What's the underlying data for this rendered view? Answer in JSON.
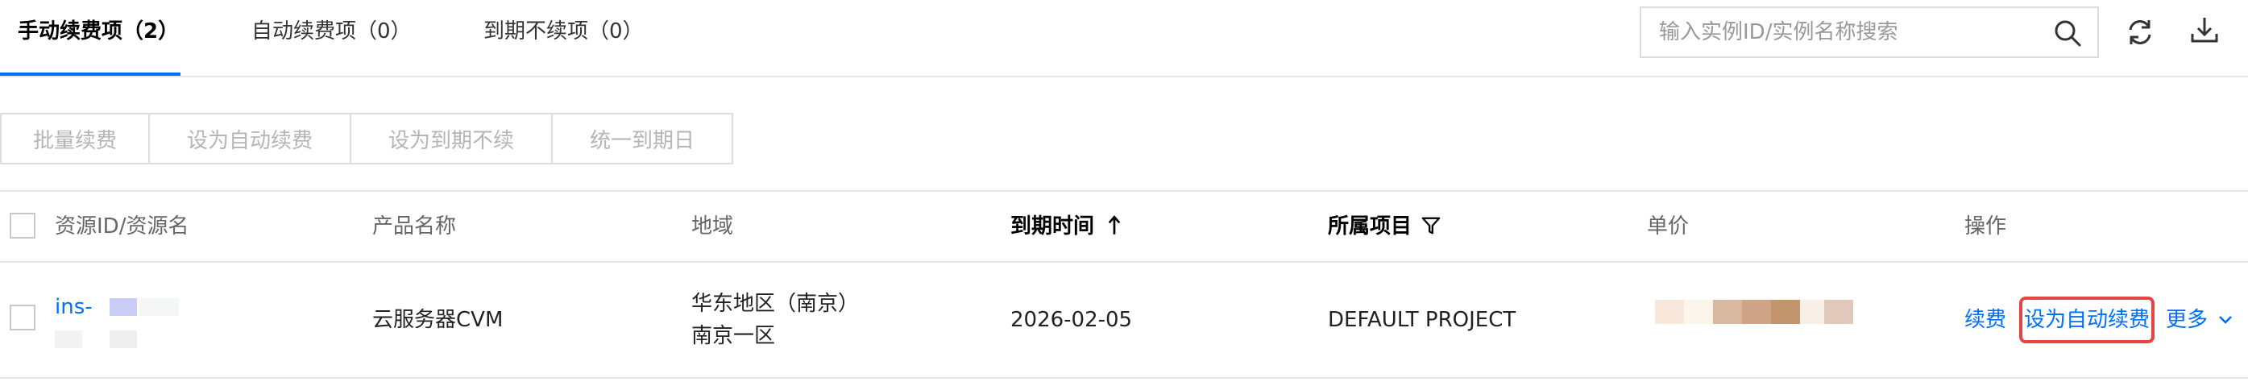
{
  "tabs": [
    {
      "label": "手动续费项（2）",
      "active": true
    },
    {
      "label": "自动续费项（0）",
      "active": false
    },
    {
      "label": "到期不续项（0）",
      "active": false
    }
  ],
  "search": {
    "placeholder": "输入实例ID/实例名称搜索"
  },
  "toolbar_icons": [
    "refresh-icon",
    "download-icon"
  ],
  "batch_buttons": [
    "批量续费",
    "设为自动续费",
    "设为到期不续",
    "统一到期日"
  ],
  "table": {
    "headers": [
      "资源ID/资源名",
      "产品名称",
      "地域",
      "到期时间",
      "所属项目",
      "单价",
      "操作"
    ],
    "sort_indicator": "arrow-up-icon",
    "filter_indicator": "filter-icon",
    "rows": [
      {
        "resource_id": "ins-",
        "product": "云服务器CVM",
        "region_line1": "华东地区（南京）",
        "region_line2": "南京一区",
        "expire": "2026-02-05",
        "project": "DEFAULT PROJECT",
        "actions": {
          "renew": "续费",
          "auto_renew": "设为自动续费",
          "more": "更多"
        }
      }
    ]
  },
  "colors": {
    "accent": "#006eff",
    "highlight": "#e54545",
    "border": "#e5e5e5"
  }
}
